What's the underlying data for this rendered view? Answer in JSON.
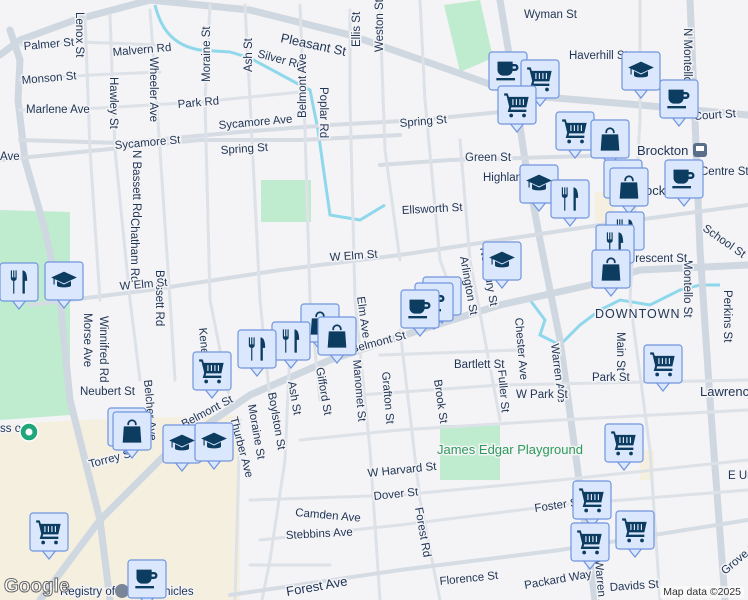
{
  "map": {
    "streets": [
      "Palmer St",
      "Malvern Rd",
      "Monson St",
      "Marlene Ave",
      "Park Rd",
      "Sycamore St",
      "Sycamore Ave",
      "Spring St",
      "Spring St",
      "Lenox St",
      "Hawley St",
      "Wheeler Ave",
      "N Bassett Rd",
      "Chatham Rd",
      "Bassett Rd",
      "Moraine St",
      "Ash St",
      "Silver Rd",
      "Belmont Ave",
      "Poplar Rd",
      "Ellis St",
      "Weston St",
      "Pleasant St",
      "Wyman St",
      "Haverhill St",
      "Court St",
      "Green St",
      "Highland St",
      "Ellsworth St",
      "W Elm St",
      "W Elm St",
      "Belmont St",
      "Belmont St",
      "Elm Ave",
      "Manomet St",
      "Grafton St",
      "Arlington St",
      "Newbury St",
      "Chester Ave",
      "Warren Ave",
      "Brook St",
      "Fuller St",
      "Bartlett St",
      "W Park St",
      "Park St",
      "Main St",
      "Montello St",
      "N Montello St",
      "School St",
      "Perkins St",
      "Crescent St",
      "Centre St",
      "Morse Ave",
      "Winnifred Rd",
      "Neubert St",
      "Belcher Ave",
      "Torrey St",
      "Thurber Ave",
      "Moraine St",
      "Boylston St",
      "Ash St",
      "Gifford St",
      "Kenelm St",
      "W Harvard St",
      "Dover St",
      "Camden Ave",
      "Stebbins Ave",
      "Forest Rd",
      "Foster St",
      "Forest Ave",
      "Florence St",
      "Packard Way",
      "Davids St",
      "E Union St",
      "Lawrence St",
      "Grove St",
      "Warren Ave",
      "Ave"
    ],
    "places": {
      "park": "James Edgar Playground",
      "downtown": "DOWNTOWN",
      "station": "Brockton",
      "city_partial": "Brock",
      "registry": "Registry of Motor Vehicles",
      "left_place": "ss on"
    },
    "markers": [
      "cup",
      "cart",
      "cart",
      "cart",
      "bag",
      "graduation-cap",
      "cup",
      "graduation-cap",
      "fork-knife",
      "bag",
      "bag",
      "cup",
      "fork-knife",
      "fork-knife",
      "bag",
      "graduation-cap",
      "cup",
      "cup",
      "cup",
      "bag",
      "bag",
      "fork-knife",
      "fork-knife",
      "cart",
      "bag",
      "bag",
      "graduation-cap",
      "graduation-cap",
      "cart",
      "cup",
      "graduation-cap",
      "fork-knife",
      "cart",
      "cart",
      "cart",
      "cart",
      "cart"
    ],
    "attribution": "Map data ©2025",
    "logo": "Google"
  },
  "colors": {
    "marker_bg": "#dbe7fc",
    "marker_border": "#6f95de",
    "icon": "#0d3c61",
    "park": "#bfeccf",
    "campus": "#f5efdf",
    "water": "#8fd8ec"
  }
}
